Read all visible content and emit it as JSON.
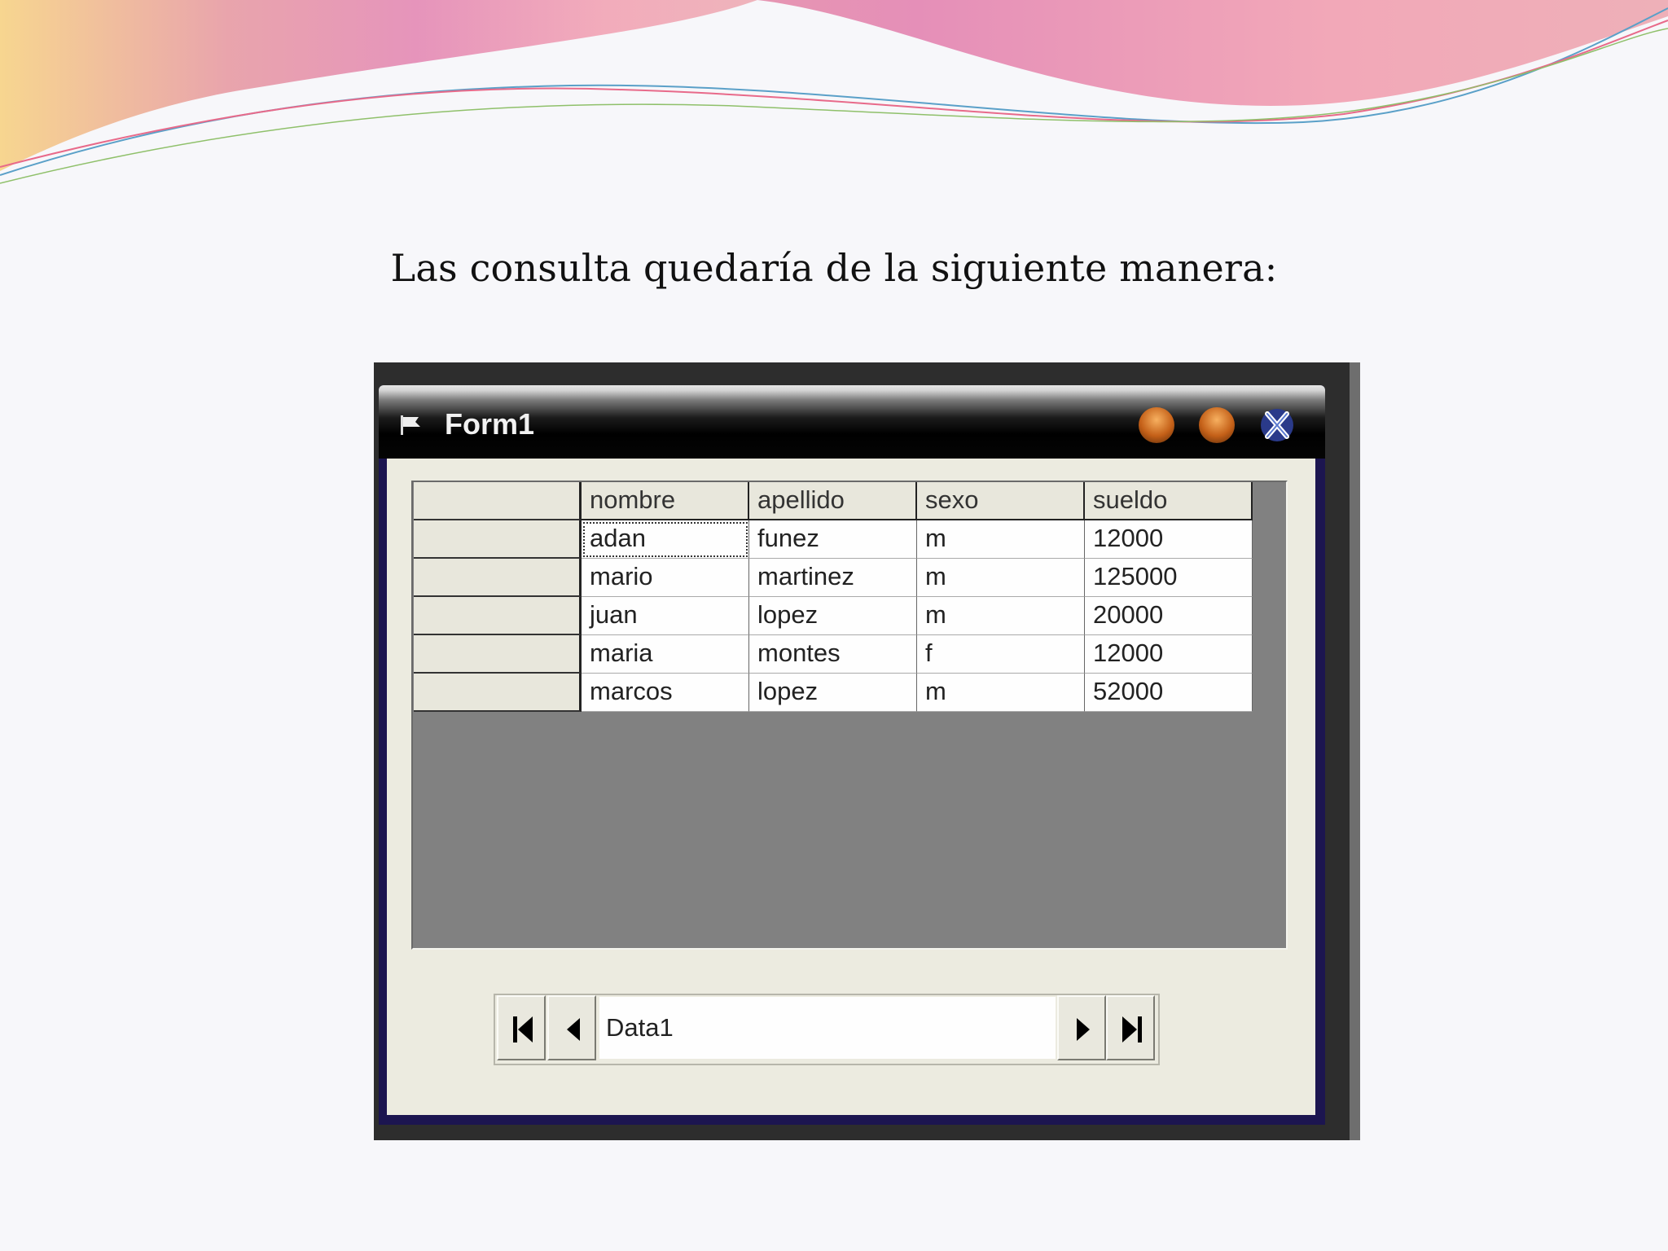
{
  "slide": {
    "heading": "Las consulta quedaría de la siguiente manera:"
  },
  "window": {
    "title": "Form1",
    "controls": [
      "minimize-icon",
      "maximize-icon",
      "close-icon"
    ]
  },
  "grid": {
    "columns": [
      "nombre",
      "apellido",
      "sexo",
      "sueldo"
    ],
    "rows": [
      [
        "adan",
        "funez",
        "m",
        "12000"
      ],
      [
        "mario",
        "martinez",
        "m",
        "125000"
      ],
      [
        "juan",
        "lopez",
        "m",
        "20000"
      ],
      [
        "maria",
        "montes",
        "f",
        "12000"
      ],
      [
        "marcos",
        "lopez",
        "m",
        "52000"
      ]
    ],
    "selected_cell": "adan"
  },
  "data_control": {
    "caption": "Data1",
    "buttons": [
      "first-record-icon",
      "previous-record-icon",
      "next-record-icon",
      "last-record-icon"
    ]
  }
}
